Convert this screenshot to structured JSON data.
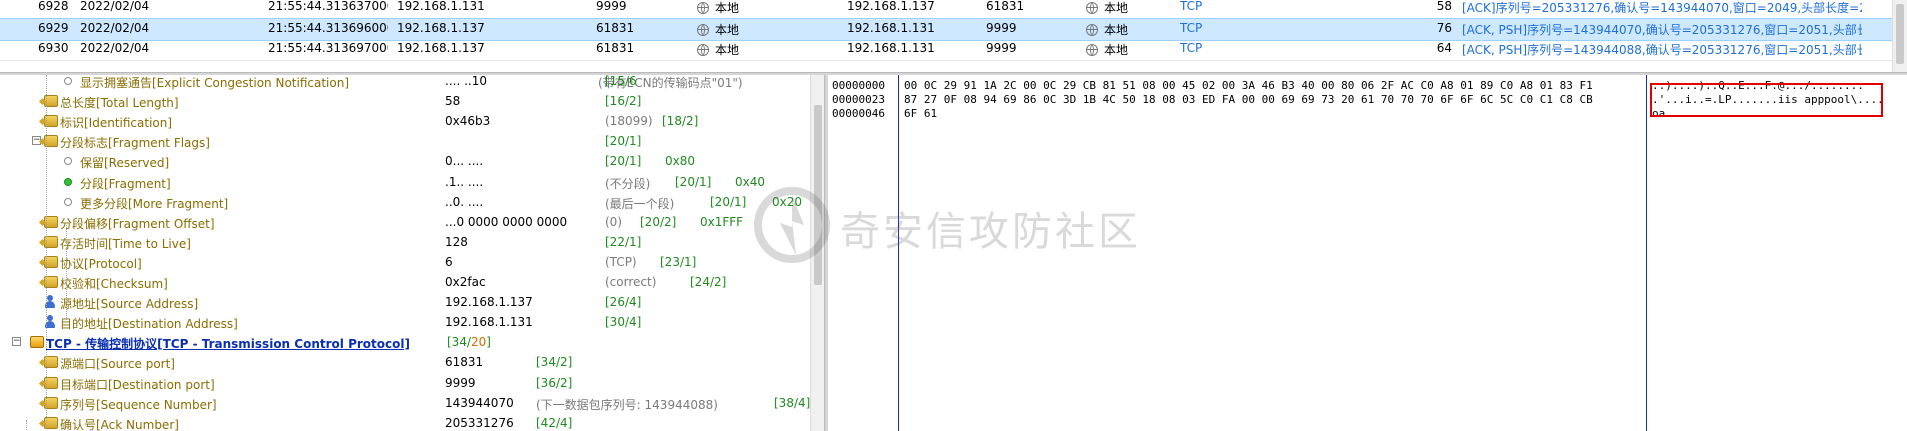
{
  "packets": [
    {
      "no": "6928",
      "date": "2022/02/04",
      "time": "21:55:44.313637000",
      "src": "192.168.1.131",
      "sport": "9999",
      "src_loc": "本地",
      "dst": "192.168.1.137",
      "dport": "61831",
      "dst_loc": "本地",
      "proto": "TCP",
      "len": "58",
      "info": "[ACK]序列号=205331276,确认号=143944070,窗口=2049,头部长度=20 ..."
    },
    {
      "no": "6929",
      "date": "2022/02/04",
      "time": "21:55:44.313696000",
      "src": "192.168.1.137",
      "sport": "61831",
      "src_loc": "本地",
      "dst": "192.168.1.131",
      "dport": "9999",
      "dst_loc": "本地",
      "proto": "TCP",
      "len": "76",
      "info": "[ACK, PSH]序列号=143944070,确认号=205331276,窗口=2051,头部长..."
    },
    {
      "no": "6930",
      "date": "2022/02/04",
      "time": "21:55:44.313697000",
      "src": "192.168.1.137",
      "sport": "61831",
      "src_loc": "本地",
      "dst": "192.168.1.131",
      "dport": "9999",
      "dst_loc": "本地",
      "proto": "TCP",
      "len": "64",
      "info": "[ACK, PSH]序列号=143944088,确认号=205331276,窗口=2051,头部长..."
    }
  ],
  "tree": [
    {
      "label": "显示拥塞通告[Explicit Congestion Notification]",
      "value": ".... ..10",
      "note": "(带有ECN的传输码点\"01\")",
      "offset": "[15/6"
    },
    {
      "label": "总长度[Total Length]",
      "value": "58",
      "offset": "[16/2]"
    },
    {
      "label": "标识[Identification]",
      "value": "0x46b3",
      "note": "(18099)",
      "offset": "[18/2]"
    },
    {
      "label": "分段标志[Fragment Flags]",
      "offset": "[20/1]"
    },
    {
      "label": "保留[Reserved]",
      "value": "0... ....",
      "offset": "[20/1]",
      "mask": "0x80"
    },
    {
      "label": "分段[Fragment]",
      "value": ".1.. ....",
      "note": "(不分段)",
      "offset": "[20/1]",
      "mask": "0x40"
    },
    {
      "label": "更多分段[More Fragment]",
      "value": "..0. ....",
      "note": "(最后一个段)",
      "offset": "[20/1]",
      "mask": "0x20"
    },
    {
      "label": "分段偏移[Fragment Offset]",
      "value": "...0 0000 0000 0000",
      "note": "(0)",
      "offset": "[20/2]",
      "mask": "0x1FFF"
    },
    {
      "label": "存活时间[Time to Live]",
      "value": "128",
      "offset": "[22/1]"
    },
    {
      "label": "协议[Protocol]",
      "value": "6",
      "note": "(TCP)",
      "offset": "[23/1]"
    },
    {
      "label": "校验和[Checksum]",
      "value": "0x2fac",
      "note": "(correct)",
      "offset": "[24/2]"
    },
    {
      "label": "源地址[Source Address]",
      "value": "192.168.1.137",
      "offset": "[26/4]"
    },
    {
      "label": "目的地址[Destination Address]",
      "value": "192.168.1.131",
      "offset": "[30/4]"
    },
    {
      "label": "TCP - 传输控制协议[TCP - Transmission Control Protocol]",
      "offset_a": "[34/",
      "offset_b": "20",
      "offset_c": "]"
    },
    {
      "label": "源端口[Source port]",
      "value": "61831",
      "offset": "[34/2]"
    },
    {
      "label": "目标端口[Destination port]",
      "value": "9999",
      "offset": "[36/2]"
    },
    {
      "label": "序列号[Sequence Number]",
      "value": "143944070",
      "note": "(下一数据包序列号: 143944088)",
      "offset": "[38/4]"
    },
    {
      "label": "确认号[Ack Number]",
      "value": "205331276",
      "offset": "[42/4]"
    }
  ],
  "hex": [
    {
      "offset": "00000000",
      "bytes": "00 0C 29 91 1A 2C 00 0C 29 CB 81 51 08 00 45 02 00 3A 46 B3 40 00 80 06 2F AC C0 A8 01 89 C0 A8 01 83 F1",
      "ascii": "..)....)..Q..E..:F.@.../........"
    },
    {
      "offset": "00000023",
      "bytes": "87 27 0F 08 94 69 86 0C 3D 1B 4C 50 18 08 03 ED FA 00 00 69 69 73 20 61 70 70 70 6F 6F 6C 5C C0 C1 C8 CB",
      "ascii": ".'...i..=.LP.......iis apppool\\...."
    },
    {
      "offset": "00000046",
      "bytes": "6F 61",
      "ascii": "oa"
    }
  ],
  "watermark": {
    "text": "奇安信攻防社区"
  },
  "colors": {
    "selection": "#cde8ff",
    "proto": "#1e6fd8",
    "offset": "#1f8a1f",
    "label": "#8a6d00",
    "highlight_box": "#e00000"
  }
}
